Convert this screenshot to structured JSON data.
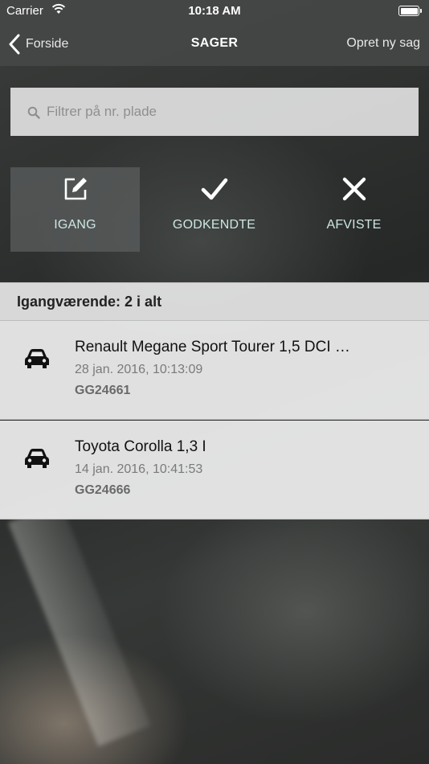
{
  "status_bar": {
    "carrier": "Carrier",
    "time": "10:18 AM",
    "battery_level": 1.0
  },
  "nav": {
    "back_label": "Forside",
    "title": "SAGER",
    "right_action": "Opret ny sag"
  },
  "search": {
    "placeholder": "Filtrer på nr. plade",
    "value": ""
  },
  "tabs": [
    {
      "label": "IGANG",
      "icon": "edit-icon",
      "active": true
    },
    {
      "label": "GODKENDTE",
      "icon": "checkmark-icon",
      "active": false
    },
    {
      "label": "AFVISTE",
      "icon": "close-icon",
      "active": false
    }
  ],
  "list": {
    "header_label": "Igangværende:",
    "header_count": "2 i alt",
    "items": [
      {
        "title": "Renault Megane Sport Tourer 1,5 DCI …",
        "date": "28 jan. 2016, 10:13:09",
        "plate": "GG24661",
        "icon": "car-icon"
      },
      {
        "title": "Toyota Corolla 1,3 I",
        "date": "14 jan. 2016, 10:41:53",
        "plate": "GG24666",
        "icon": "car-icon"
      }
    ]
  },
  "colors": {
    "accent_text": "#cde7e3",
    "bar_bg": "#464848",
    "list_bg": "#e8e8e8"
  }
}
